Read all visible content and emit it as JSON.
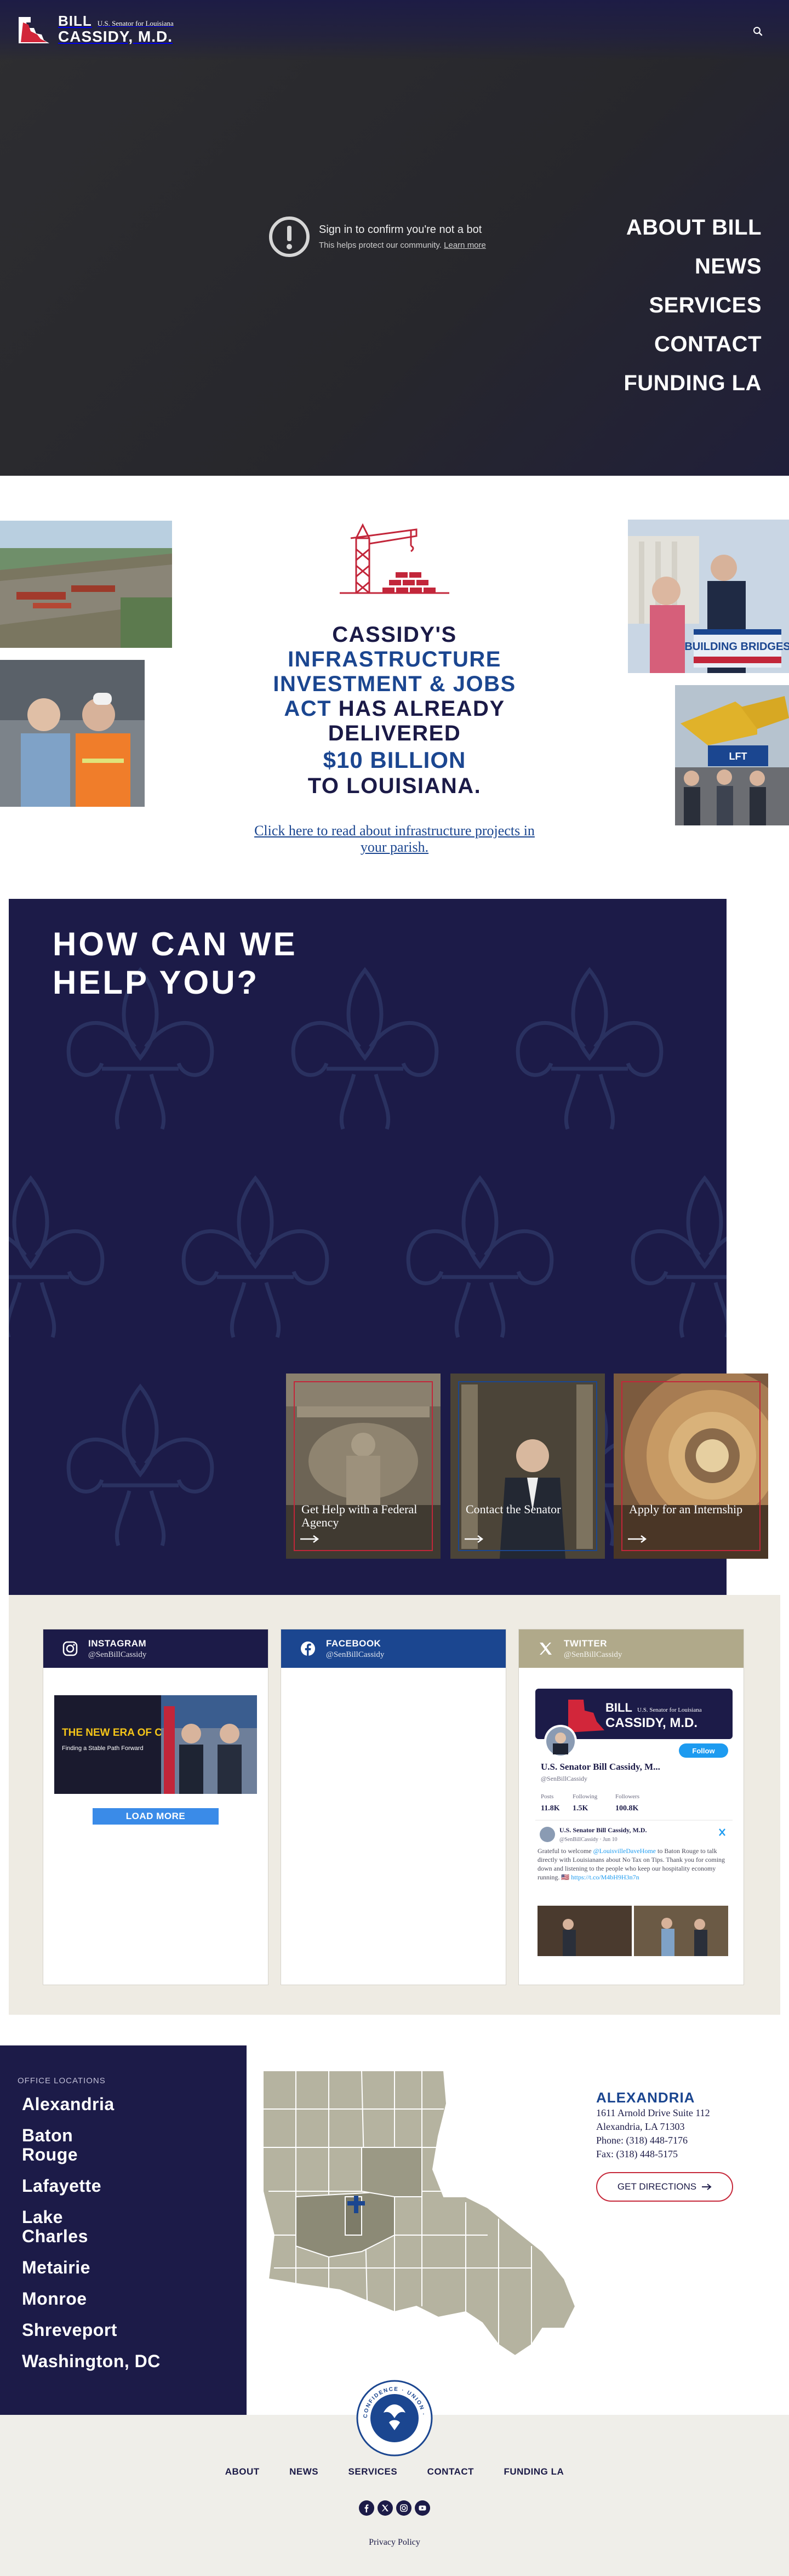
{
  "header": {
    "logo_first": "BILL",
    "logo_subtitle": "U.S. Senator for Louisiana",
    "logo_last": "CASSIDY, M.D."
  },
  "captcha": {
    "title": "Sign in to confirm you're not a bot",
    "subtitle": "This helps protect our community.",
    "learn_more": "Learn more"
  },
  "main_nav": [
    "ABOUT BILL",
    "NEWS",
    "SERVICES",
    "CONTACT",
    "FUNDING LA"
  ],
  "infrastructure": {
    "line1": "CASSIDY'S",
    "line2": "INFRASTRUCTURE",
    "line3": "INVESTMENT & JOBS",
    "line4_blue": "ACT",
    "line4_rest": "HAS ALREADY",
    "line5": "DELIVERED",
    "amount": "$10 BILLION",
    "line6": "TO LOUISIANA.",
    "link": "Click here to read about infrastructure projects in your parish.",
    "photo_sign": "BUILDING BRIDGES",
    "photo_vest": "LFT"
  },
  "help": {
    "title": "HOW CAN WE HELP YOU?",
    "cards": [
      {
        "label": "Get Help with a Federal Agency",
        "frame": "#c2263a"
      },
      {
        "label": "Contact the Senator",
        "frame": "#1b4690"
      },
      {
        "label": "Apply for an Internship",
        "frame": "#c2263a"
      }
    ]
  },
  "social": {
    "instagram": {
      "name": "INSTAGRAM",
      "handle": "@SenBillCassidy",
      "post_headline": "THE NEW ERA OF COLLEGE SPORTS",
      "post_sub": "Finding a Stable Path Forward",
      "load_more": "LOAD MORE",
      "color": "#1c1b48"
    },
    "facebook": {
      "name": "FACEBOOK",
      "handle": "@SenBillCassidy",
      "color": "#1b4690"
    },
    "twitter": {
      "name": "TWITTER",
      "handle": "@SenBillCassidy",
      "color": "#b0a98a",
      "banner_bill": "BILL",
      "banner_sub": "U.S. Senator for Louisiana",
      "banner_name": "CASSIDY, M.D.",
      "follow": "Follow",
      "profile_name": "U.S. Senator Bill Cassidy, M...",
      "profile_handle": "@SenBillCassidy",
      "stats": [
        {
          "label": "Posts",
          "value": "11.8K"
        },
        {
          "label": "Following",
          "value": "1.5K"
        },
        {
          "label": "Followers",
          "value": "100.8K"
        }
      ],
      "tweet_author": "U.S. Senator Bill Cassidy, M.D.",
      "tweet_handle": "@SenBillCassidy · Jun 10",
      "tweet_text_1": "Grateful to welcome ",
      "tweet_mention": "@LouisvilleDaveHome",
      "tweet_text_2": " to Baton Rouge to talk directly with Louisianans about No Tax on Tips. Thank you for coming down and listening to the people who keep our hospitality economy running. 🇺🇸",
      "tweet_link": "https://t.co/M4bH9H3n7n"
    }
  },
  "offices": {
    "label": "OFFICE LOCATIONS",
    "list": [
      "Alexandria",
      "Baton Rouge",
      "Lafayette",
      "Lake Charles",
      "Metairie",
      "Monroe",
      "Shreveport",
      "Washington, DC"
    ],
    "selected": {
      "city": "ALEXANDRIA",
      "address": "1611 Arnold Drive Suite 112",
      "citystate": "Alexandria, LA 71303",
      "phone": "Phone: (318) 448-7176",
      "fax": "Fax: (318) 448-5175",
      "directions": "GET DIRECTIONS"
    }
  },
  "footer": {
    "nav": [
      "ABOUT",
      "NEWS",
      "SERVICES",
      "CONTACT",
      "FUNDING LA"
    ],
    "seal_text": "CONFIDENCE · UNION · JUSTICE",
    "privacy": "Privacy Policy"
  }
}
